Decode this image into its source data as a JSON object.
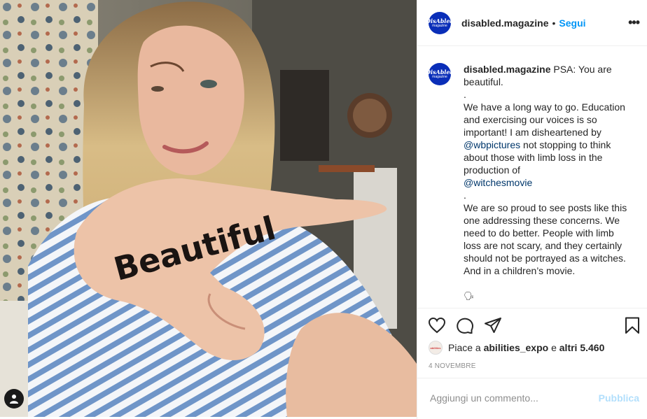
{
  "post": {
    "account": "disabled.magazine",
    "avatar_text_1": "DisAbled",
    "avatar_text_2": "magazine",
    "separator": "•",
    "follow_label": "Segui",
    "more_label": "•••",
    "photo_text": "Beautiful"
  },
  "caption": {
    "username": "disabled.magazine",
    "lines": [
      "PSA: You are beautiful.",
      ".",
      "We have a long way to go. Education and exercising our voices is so important! I am disheartened by",
      "not stopping to think about those with limb loss in the production of",
      ".",
      "We are so proud to see posts like this one addressing these concerns. We need to do better. People with limb loss are not scary, and they certainly should not be portrayed as a witches. And in a children’s movie.",
      "🗣"
    ],
    "mention_1": "@wbpictures",
    "mention_2": "@witchesmovie"
  },
  "actions": {
    "like_icon": "heart-icon",
    "comment_icon": "comment-icon",
    "share_icon": "share-icon",
    "save_icon": "bookmark-icon"
  },
  "likes": {
    "prefix": "Piace a",
    "user": "abilities_expo",
    "middle": "e",
    "others": "altri 5.460",
    "mini_avatar_text": "abilities"
  },
  "date": "4 NOVEMBRE",
  "comment_box": {
    "placeholder": "Aggiungi un commento...",
    "publish_label": "Pubblica"
  },
  "colors": {
    "link_blue": "#0095f6",
    "mention_blue": "#00376b",
    "avatar_blue": "#0a2eb8",
    "publish_disabled": "#b2dffc"
  }
}
